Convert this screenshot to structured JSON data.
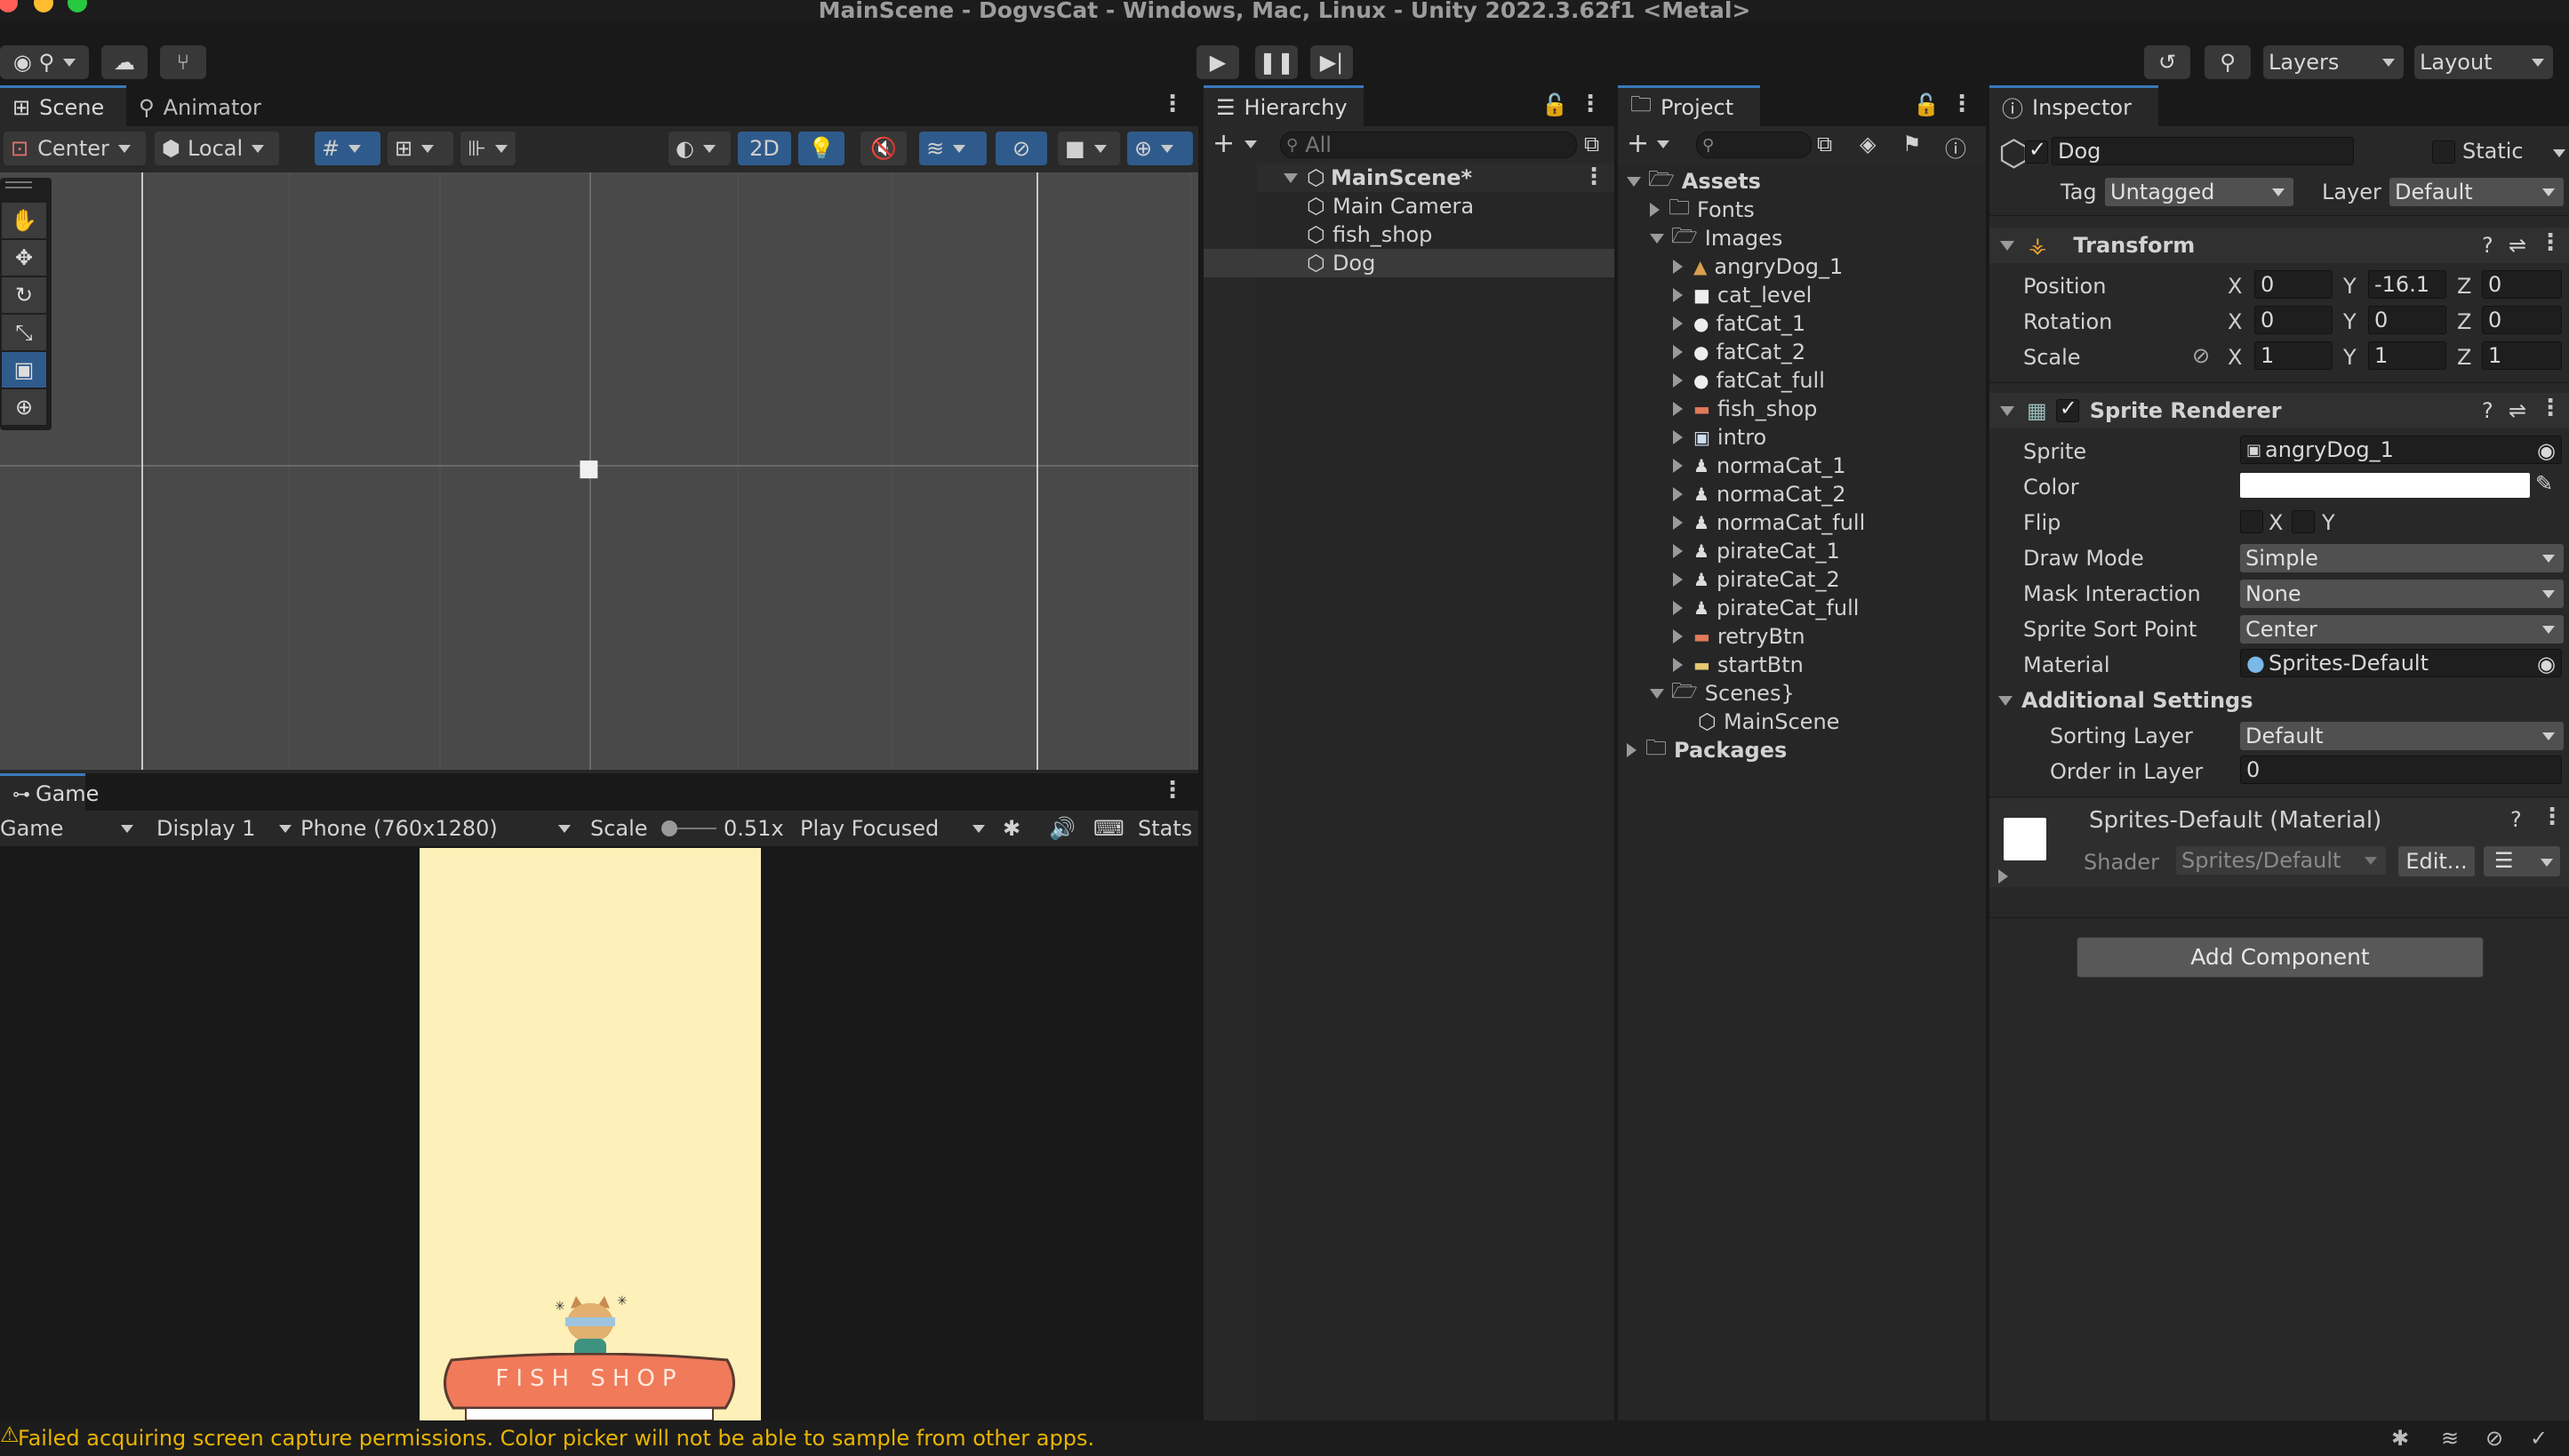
{
  "window": {
    "title": "MainScene - DogvsCat - Windows, Mac, Linux - Unity 2022.3.62f1 <Metal>"
  },
  "toolbar": {
    "layers_label": "Layers",
    "layout_label": "Layout"
  },
  "scene_panel": {
    "tabs": [
      "Scene",
      "Animator"
    ],
    "pivot_mode": "Center",
    "pivot_rotation": "Local",
    "mode_2d": "2D"
  },
  "game_panel": {
    "tab": "Game",
    "view_select": "Game",
    "display": "Display 1",
    "resolution": "Phone (760x1280)",
    "scale_label": "Scale",
    "scale_value": "0.51x",
    "play_mode": "Play Focused",
    "stats": "Stats",
    "sign_text": "FISH SHOP"
  },
  "hierarchy": {
    "tab": "Hierarchy",
    "search_placeholder": "All",
    "scene": "MainScene*",
    "items": [
      "Main Camera",
      "fish_shop",
      "Dog"
    ]
  },
  "project": {
    "tab": "Project",
    "assets": "Assets",
    "fonts": "Fonts",
    "images": "Images",
    "image_items": [
      "angryDog_1",
      "cat_level",
      "fatCat_1",
      "fatCat_2",
      "fatCat_full",
      "fish_shop",
      "intro",
      "normaCat_1",
      "normaCat_2",
      "normaCat_full",
      "pirateCat_1",
      "pirateCat_2",
      "pirateCat_full",
      "retryBtn",
      "startBtn"
    ],
    "scenes": "Scenes",
    "scene_item": "MainScene",
    "packages": "Packages"
  },
  "inspector": {
    "tab": "Inspector",
    "object_name": "Dog",
    "static_label": "Static",
    "tag_label": "Tag",
    "tag_value": "Untagged",
    "layer_label": "Layer",
    "layer_value": "Default",
    "transform": {
      "title": "Transform",
      "position_label": "Position",
      "rotation_label": "Rotation",
      "scale_label": "Scale",
      "position": {
        "x": "0",
        "y": "-16.1",
        "z": "0"
      },
      "rotation": {
        "x": "0",
        "y": "0",
        "z": "0"
      },
      "scale": {
        "x": "1",
        "y": "1",
        "z": "1"
      }
    },
    "sprite_renderer": {
      "title": "Sprite Renderer",
      "sprite_label": "Sprite",
      "sprite_value": "angryDog_1",
      "color_label": "Color",
      "flip_label": "Flip",
      "flip_x": "X",
      "flip_y": "Y",
      "draw_mode_label": "Draw Mode",
      "draw_mode_value": "Simple",
      "mask_label": "Mask Interaction",
      "mask_value": "None",
      "sort_point_label": "Sprite Sort Point",
      "sort_point_value": "Center",
      "material_label": "Material",
      "material_value": "Sprites-Default",
      "additional_label": "Additional Settings",
      "sorting_layer_label": "Sorting Layer",
      "sorting_layer_value": "Default",
      "order_label": "Order in Layer",
      "order_value": "0"
    },
    "material": {
      "title": "Sprites-Default (Material)",
      "shader_label": "Shader",
      "shader_value": "Sprites/Default",
      "edit_label": "Edit..."
    },
    "add_component": "Add Component",
    "axis_labels": {
      "x": "X",
      "y": "Y",
      "z": "Z"
    }
  },
  "status_bar": {
    "message": "Failed acquiring screen capture permissions. Color picker will not be able to sample from other apps."
  },
  "colors": {
    "accent_blue": "#2f5b8c",
    "game_bg": "#fdf0b8",
    "sign_color": "#f07a5a",
    "warning": "#e8b400"
  }
}
